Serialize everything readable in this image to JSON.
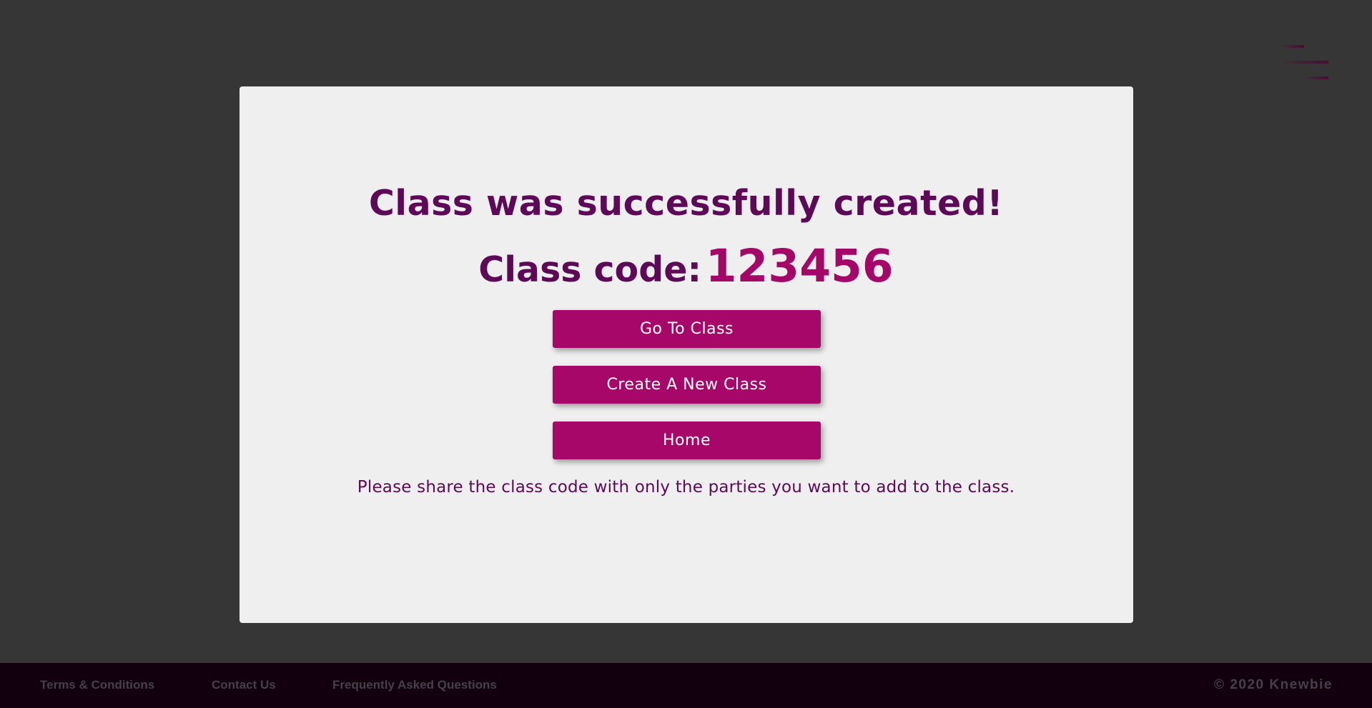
{
  "menu": {
    "icon": "hamburger-menu-icon"
  },
  "modal": {
    "title": "Class was successfully created!",
    "code_label": "Class code:",
    "code_value": "123456",
    "buttons": [
      {
        "label": "Go To Class"
      },
      {
        "label": "Create A New Class"
      },
      {
        "label": "Home"
      }
    ],
    "note": "Please share the class code with only the parties you want to add to the class."
  },
  "footer": {
    "links": [
      {
        "label": "Terms & Conditions"
      },
      {
        "label": "Contact Us"
      },
      {
        "label": "Frequently Asked Questions"
      }
    ],
    "copyright": "© 2020 Knewbie"
  },
  "colors": {
    "page_background": "#363636",
    "modal_background": "#efefef",
    "heading": "#5e0858",
    "accent": "#a70768",
    "footer_background": "#12000f",
    "footer_text": "#484048"
  }
}
